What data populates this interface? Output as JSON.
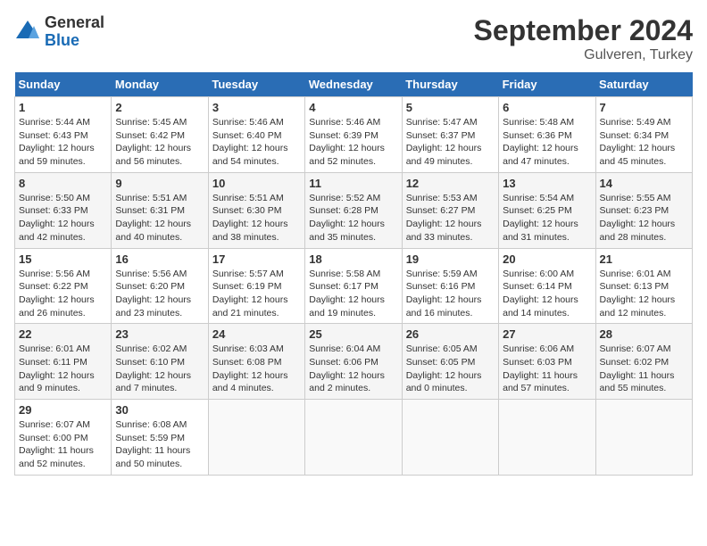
{
  "logo": {
    "general": "General",
    "blue": "Blue"
  },
  "title": "September 2024",
  "location": "Gulveren, Turkey",
  "weekdays": [
    "Sunday",
    "Monday",
    "Tuesday",
    "Wednesday",
    "Thursday",
    "Friday",
    "Saturday"
  ],
  "weeks": [
    [
      {
        "day": "1",
        "sunrise": "Sunrise: 5:44 AM",
        "sunset": "Sunset: 6:43 PM",
        "daylight": "Daylight: 12 hours and 59 minutes."
      },
      {
        "day": "2",
        "sunrise": "Sunrise: 5:45 AM",
        "sunset": "Sunset: 6:42 PM",
        "daylight": "Daylight: 12 hours and 56 minutes."
      },
      {
        "day": "3",
        "sunrise": "Sunrise: 5:46 AM",
        "sunset": "Sunset: 6:40 PM",
        "daylight": "Daylight: 12 hours and 54 minutes."
      },
      {
        "day": "4",
        "sunrise": "Sunrise: 5:46 AM",
        "sunset": "Sunset: 6:39 PM",
        "daylight": "Daylight: 12 hours and 52 minutes."
      },
      {
        "day": "5",
        "sunrise": "Sunrise: 5:47 AM",
        "sunset": "Sunset: 6:37 PM",
        "daylight": "Daylight: 12 hours and 49 minutes."
      },
      {
        "day": "6",
        "sunrise": "Sunrise: 5:48 AM",
        "sunset": "Sunset: 6:36 PM",
        "daylight": "Daylight: 12 hours and 47 minutes."
      },
      {
        "day": "7",
        "sunrise": "Sunrise: 5:49 AM",
        "sunset": "Sunset: 6:34 PM",
        "daylight": "Daylight: 12 hours and 45 minutes."
      }
    ],
    [
      {
        "day": "8",
        "sunrise": "Sunrise: 5:50 AM",
        "sunset": "Sunset: 6:33 PM",
        "daylight": "Daylight: 12 hours and 42 minutes."
      },
      {
        "day": "9",
        "sunrise": "Sunrise: 5:51 AM",
        "sunset": "Sunset: 6:31 PM",
        "daylight": "Daylight: 12 hours and 40 minutes."
      },
      {
        "day": "10",
        "sunrise": "Sunrise: 5:51 AM",
        "sunset": "Sunset: 6:30 PM",
        "daylight": "Daylight: 12 hours and 38 minutes."
      },
      {
        "day": "11",
        "sunrise": "Sunrise: 5:52 AM",
        "sunset": "Sunset: 6:28 PM",
        "daylight": "Daylight: 12 hours and 35 minutes."
      },
      {
        "day": "12",
        "sunrise": "Sunrise: 5:53 AM",
        "sunset": "Sunset: 6:27 PM",
        "daylight": "Daylight: 12 hours and 33 minutes."
      },
      {
        "day": "13",
        "sunrise": "Sunrise: 5:54 AM",
        "sunset": "Sunset: 6:25 PM",
        "daylight": "Daylight: 12 hours and 31 minutes."
      },
      {
        "day": "14",
        "sunrise": "Sunrise: 5:55 AM",
        "sunset": "Sunset: 6:23 PM",
        "daylight": "Daylight: 12 hours and 28 minutes."
      }
    ],
    [
      {
        "day": "15",
        "sunrise": "Sunrise: 5:56 AM",
        "sunset": "Sunset: 6:22 PM",
        "daylight": "Daylight: 12 hours and 26 minutes."
      },
      {
        "day": "16",
        "sunrise": "Sunrise: 5:56 AM",
        "sunset": "Sunset: 6:20 PM",
        "daylight": "Daylight: 12 hours and 23 minutes."
      },
      {
        "day": "17",
        "sunrise": "Sunrise: 5:57 AM",
        "sunset": "Sunset: 6:19 PM",
        "daylight": "Daylight: 12 hours and 21 minutes."
      },
      {
        "day": "18",
        "sunrise": "Sunrise: 5:58 AM",
        "sunset": "Sunset: 6:17 PM",
        "daylight": "Daylight: 12 hours and 19 minutes."
      },
      {
        "day": "19",
        "sunrise": "Sunrise: 5:59 AM",
        "sunset": "Sunset: 6:16 PM",
        "daylight": "Daylight: 12 hours and 16 minutes."
      },
      {
        "day": "20",
        "sunrise": "Sunrise: 6:00 AM",
        "sunset": "Sunset: 6:14 PM",
        "daylight": "Daylight: 12 hours and 14 minutes."
      },
      {
        "day": "21",
        "sunrise": "Sunrise: 6:01 AM",
        "sunset": "Sunset: 6:13 PM",
        "daylight": "Daylight: 12 hours and 12 minutes."
      }
    ],
    [
      {
        "day": "22",
        "sunrise": "Sunrise: 6:01 AM",
        "sunset": "Sunset: 6:11 PM",
        "daylight": "Daylight: 12 hours and 9 minutes."
      },
      {
        "day": "23",
        "sunrise": "Sunrise: 6:02 AM",
        "sunset": "Sunset: 6:10 PM",
        "daylight": "Daylight: 12 hours and 7 minutes."
      },
      {
        "day": "24",
        "sunrise": "Sunrise: 6:03 AM",
        "sunset": "Sunset: 6:08 PM",
        "daylight": "Daylight: 12 hours and 4 minutes."
      },
      {
        "day": "25",
        "sunrise": "Sunrise: 6:04 AM",
        "sunset": "Sunset: 6:06 PM",
        "daylight": "Daylight: 12 hours and 2 minutes."
      },
      {
        "day": "26",
        "sunrise": "Sunrise: 6:05 AM",
        "sunset": "Sunset: 6:05 PM",
        "daylight": "Daylight: 12 hours and 0 minutes."
      },
      {
        "day": "27",
        "sunrise": "Sunrise: 6:06 AM",
        "sunset": "Sunset: 6:03 PM",
        "daylight": "Daylight: 11 hours and 57 minutes."
      },
      {
        "day": "28",
        "sunrise": "Sunrise: 6:07 AM",
        "sunset": "Sunset: 6:02 PM",
        "daylight": "Daylight: 11 hours and 55 minutes."
      }
    ],
    [
      {
        "day": "29",
        "sunrise": "Sunrise: 6:07 AM",
        "sunset": "Sunset: 6:00 PM",
        "daylight": "Daylight: 11 hours and 52 minutes."
      },
      {
        "day": "30",
        "sunrise": "Sunrise: 6:08 AM",
        "sunset": "Sunset: 5:59 PM",
        "daylight": "Daylight: 11 hours and 50 minutes."
      },
      null,
      null,
      null,
      null,
      null
    ]
  ]
}
